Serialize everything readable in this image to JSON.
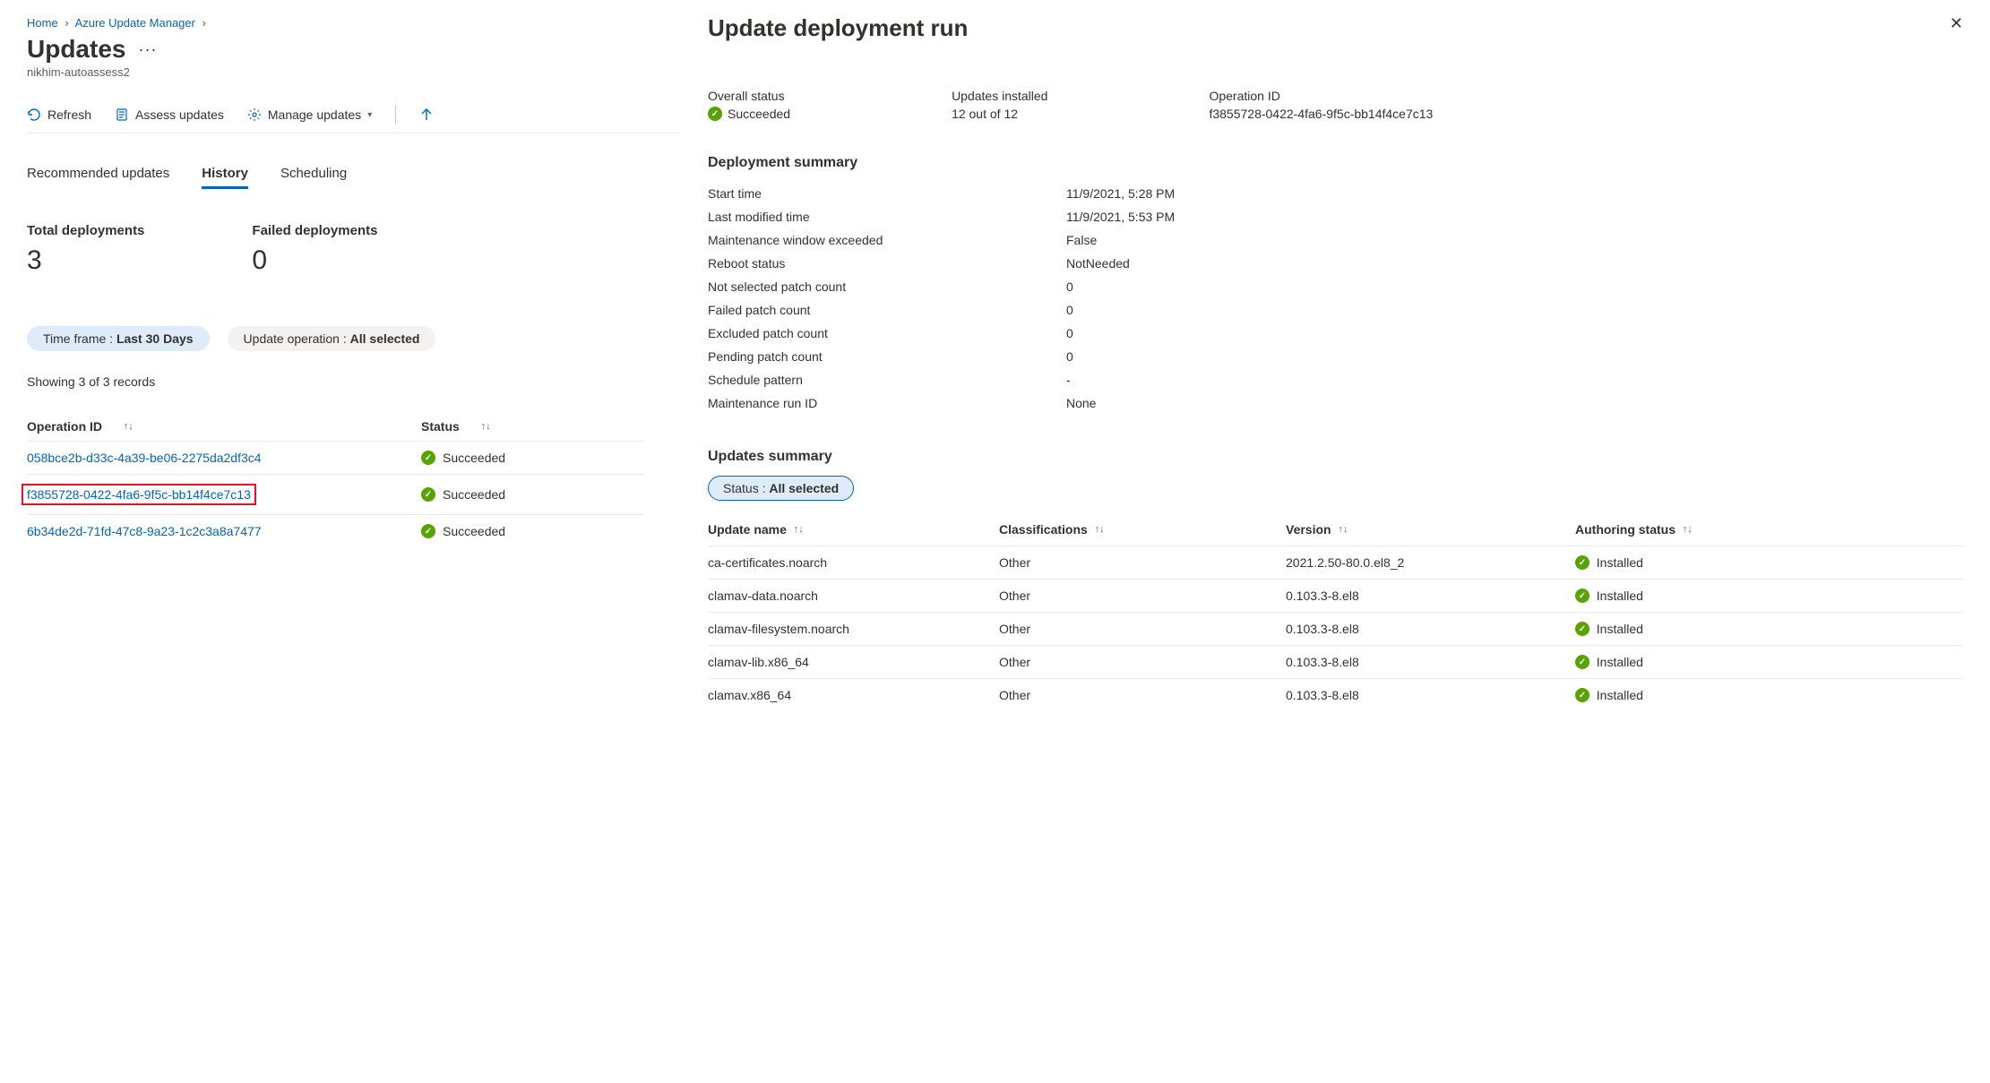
{
  "breadcrumb": {
    "home": "Home",
    "aum": "Azure Update Manager"
  },
  "page": {
    "title": "Updates",
    "subtitle": "nikhim-autoassess2"
  },
  "toolbar": {
    "refresh": "Refresh",
    "assess": "Assess updates",
    "manage": "Manage updates"
  },
  "tabs": {
    "recommended": "Recommended updates",
    "history": "History",
    "scheduling": "Scheduling"
  },
  "stats": {
    "total_label": "Total deployments",
    "total_value": "3",
    "failed_label": "Failed deployments",
    "failed_value": "0"
  },
  "filters": {
    "timeframe_label": "Time frame : ",
    "timeframe_value": "Last 30 Days",
    "updateop_label": "Update operation : ",
    "updateop_value": "All selected"
  },
  "records_text": "Showing 3 of 3 records",
  "history_headers": {
    "op": "Operation ID",
    "status": "Status"
  },
  "history_rows": [
    {
      "op": "058bce2b-d33c-4a39-be06-2275da2df3c4",
      "status": "Succeeded",
      "hl": false
    },
    {
      "op": "f3855728-0422-4fa6-9f5c-bb14f4ce7c13",
      "status": "Succeeded",
      "hl": true
    },
    {
      "op": "6b34de2d-71fd-47c8-9a23-1c2c3a8a7477",
      "status": "Succeeded",
      "hl": false
    }
  ],
  "panel": {
    "title": "Update deployment run",
    "overall_status_label": "Overall status",
    "overall_status_value": "Succeeded",
    "updates_installed_label": "Updates installed",
    "updates_installed_value": "12 out of 12",
    "operation_id_label": "Operation ID",
    "operation_id_value": "f3855728-0422-4fa6-9f5c-bb14f4ce7c13",
    "summary_header": "Deployment summary",
    "kv": [
      {
        "k": "Start time",
        "v": "11/9/2021, 5:28 PM"
      },
      {
        "k": "Last modified time",
        "v": "11/9/2021, 5:53 PM"
      },
      {
        "k": "Maintenance window exceeded",
        "v": "False"
      },
      {
        "k": "Reboot status",
        "v": "NotNeeded"
      },
      {
        "k": "Not selected patch count",
        "v": "0"
      },
      {
        "k": "Failed patch count",
        "v": "0"
      },
      {
        "k": "Excluded patch count",
        "v": "0"
      },
      {
        "k": "Pending patch count",
        "v": "0"
      },
      {
        "k": "Schedule pattern",
        "v": "-"
      },
      {
        "k": "Maintenance run ID",
        "v": "None"
      }
    ],
    "updates_summary_header": "Updates summary",
    "status_filter_label": "Status : ",
    "status_filter_value": "All selected",
    "uheaders": {
      "name": "Update name",
      "class": "Classifications",
      "ver": "Version",
      "auth": "Authoring status"
    },
    "urows": [
      {
        "name": "ca-certificates.noarch",
        "class": "Other",
        "ver": "2021.2.50-80.0.el8_2",
        "auth": "Installed"
      },
      {
        "name": "clamav-data.noarch",
        "class": "Other",
        "ver": "0.103.3-8.el8",
        "auth": "Installed"
      },
      {
        "name": "clamav-filesystem.noarch",
        "class": "Other",
        "ver": "0.103.3-8.el8",
        "auth": "Installed"
      },
      {
        "name": "clamav-lib.x86_64",
        "class": "Other",
        "ver": "0.103.3-8.el8",
        "auth": "Installed"
      },
      {
        "name": "clamav.x86_64",
        "class": "Other",
        "ver": "0.103.3-8.el8",
        "auth": "Installed"
      }
    ]
  }
}
